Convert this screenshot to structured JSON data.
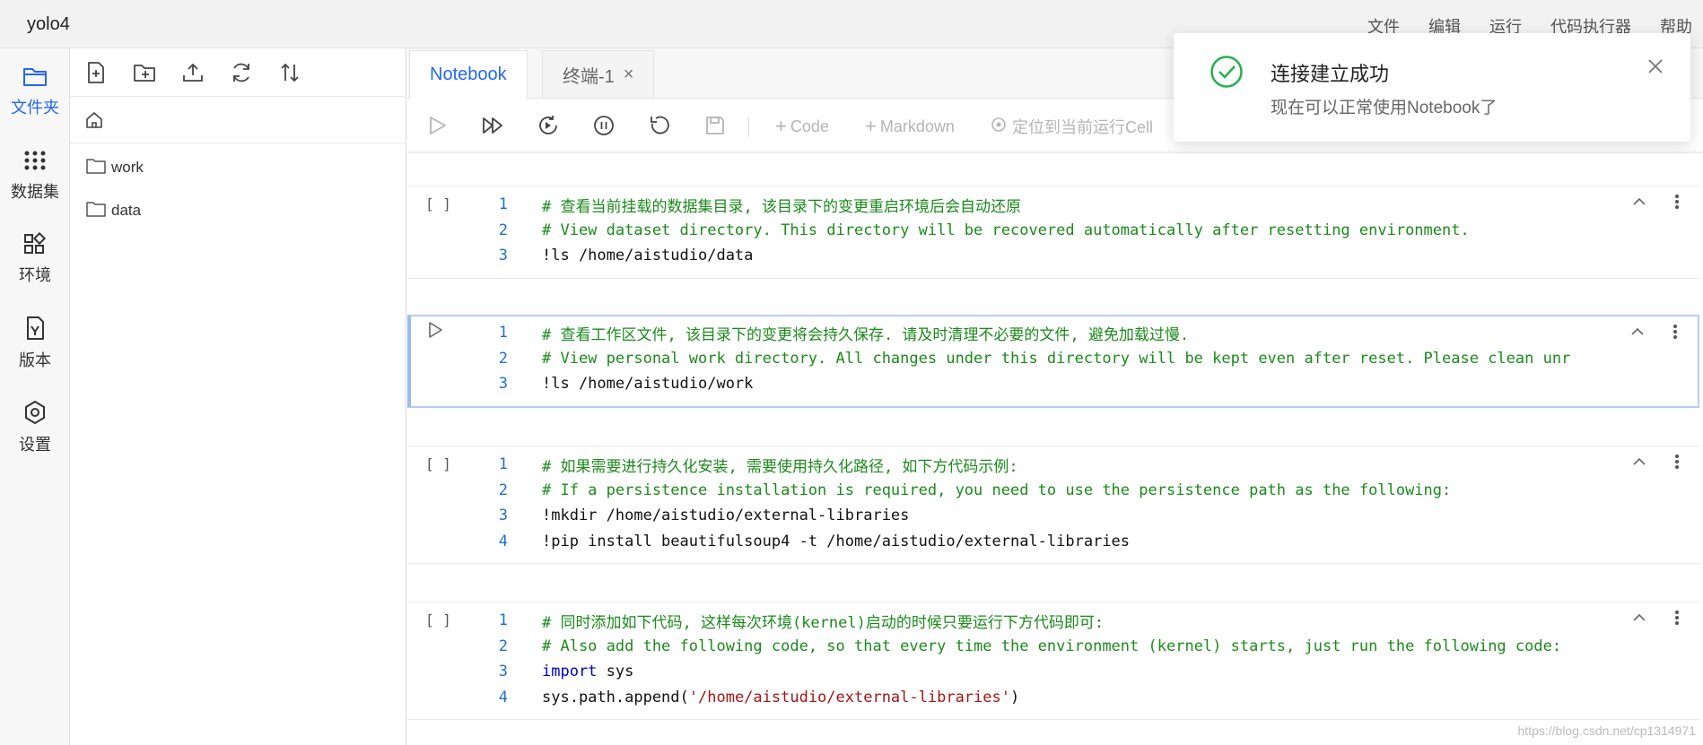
{
  "app": {
    "title": "yolo4"
  },
  "topmenu": [
    "文件",
    "编辑",
    "运行",
    "代码执行器",
    "帮助"
  ],
  "leftnav": [
    {
      "label": "文件夹",
      "icon": "folder-icon",
      "active": true
    },
    {
      "label": "数据集",
      "icon": "dataset-icon",
      "active": false
    },
    {
      "label": "环境",
      "icon": "environment-icon",
      "active": false
    },
    {
      "label": "版本",
      "icon": "version-icon",
      "active": false
    },
    {
      "label": "设置",
      "icon": "settings-icon",
      "active": false
    }
  ],
  "filepanel": {
    "toolbar": [
      "new-file-icon",
      "new-folder-icon",
      "upload-icon",
      "refresh-icon",
      "sort-icon"
    ],
    "crumb_icon": "home-icon",
    "items": [
      {
        "name": "work",
        "icon": "folder-icon"
      },
      {
        "name": "data",
        "icon": "folder-icon"
      }
    ]
  },
  "tabs": [
    {
      "label": "Notebook",
      "active": true
    },
    {
      "label": "终端-1",
      "active": false,
      "closable": true
    }
  ],
  "nbtoolbar": {
    "add_code": "Code",
    "add_markdown": "Markdown",
    "locate": "定位到当前运行Cell"
  },
  "cells": [
    {
      "prompt": "[ ]",
      "lines": [
        {
          "n": "1",
          "text": "# 查看当前挂载的数据集目录, 该目录下的变更重启环境后会自动还原",
          "type": "comment"
        },
        {
          "n": "2",
          "text": "# View dataset directory. This directory will be recovered automatically after resetting environment.",
          "type": "comment"
        },
        {
          "n": "3",
          "text": "!ls /home/aistudio/data",
          "type": "code"
        }
      ]
    },
    {
      "prompt": "▷",
      "selected": true,
      "lines": [
        {
          "n": "1",
          "text": "# 查看工作区文件, 该目录下的变更将会持久保存. 请及时清理不必要的文件, 避免加载过慢.",
          "type": "comment"
        },
        {
          "n": "2",
          "text": "# View personal work directory. All changes under this directory will be kept even after reset. Please clean unr",
          "type": "comment"
        },
        {
          "n": "3",
          "text": "!ls /home/aistudio/work",
          "type": "code"
        }
      ]
    },
    {
      "prompt": "[ ]",
      "lines": [
        {
          "n": "1",
          "text": "# 如果需要进行持久化安装, 需要使用持久化路径, 如下方代码示例:",
          "type": "comment"
        },
        {
          "n": "2",
          "text": "# If a persistence installation is required, you need to use the persistence path as the following:",
          "type": "comment"
        },
        {
          "n": "3",
          "text": "!mkdir /home/aistudio/external-libraries",
          "type": "code"
        },
        {
          "n": "4",
          "text": "!pip install beautifulsoup4 -t /home/aistudio/external-libraries",
          "type": "code"
        }
      ]
    },
    {
      "prompt": "[ ]",
      "lines": [
        {
          "n": "1",
          "text": "# 同时添加如下代码, 这样每次环境(kernel)启动的时候只要运行下方代码即可:",
          "type": "comment"
        },
        {
          "n": "2",
          "text": "# Also add the following code, so that every time the environment (kernel) starts, just run the following code:",
          "type": "comment"
        },
        {
          "n": "3",
          "kw": "import",
          "text": " sys",
          "type": "kwline"
        },
        {
          "n": "4",
          "pre": "sys.path.append(",
          "str": "'/home/aistudio/external-libraries'",
          "post": ")",
          "type": "strline"
        }
      ]
    }
  ],
  "toast": {
    "title": "连接建立成功",
    "message": "现在可以正常使用Notebook了"
  },
  "watermark": "https://blog.csdn.net/cp1314971",
  "colors": {
    "accent": "#2468f2",
    "comment": "#1c8a1c",
    "success": "#22b14c"
  }
}
